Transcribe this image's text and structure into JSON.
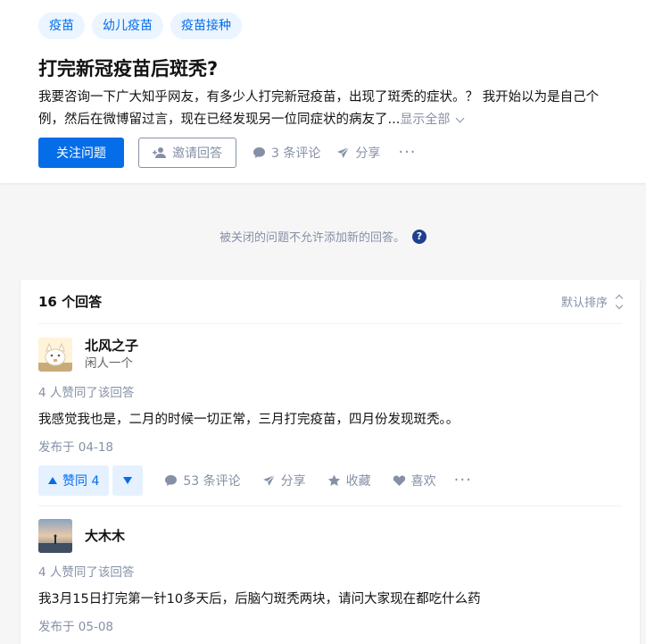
{
  "question": {
    "topics": [
      "疫苗",
      "幼儿疫苗",
      "疫苗接种"
    ],
    "title": "打完新冠疫苗后斑秃?",
    "detail_line1": "我要咨询一下广大知乎网友，有多少人打完新冠疫苗，出现了斑秃的症状。？ 我开始以为是自己个",
    "detail_line2": "例，然后在微博留过言，现在已经发现另一位同症状的病友了...",
    "show_all": "显示全部",
    "follow_label": "关注问题",
    "invite_label": "邀请回答",
    "comments_label": "3 条评论",
    "share_label": "分享",
    "more": "···"
  },
  "closed_notice": "被关闭的问题不允许添加新的回答。",
  "help_icon_glyph": "?",
  "answers_header": {
    "count_label": "16 个回答",
    "sort_label": "默认排序"
  },
  "answers": [
    {
      "author": "北风之子",
      "bio": "闲人一个",
      "votes_meta": "4 人赞同了该回答",
      "text": "我感觉我也是，二月的时候一切正常，三月打完疫苗，四月份发现斑秃。。",
      "time": "发布于 04-18",
      "upvote_label": "赞同 4",
      "comments": "53 条评论",
      "share": "分享",
      "collect": "收藏",
      "like": "喜欢",
      "more": "···"
    },
    {
      "author": "大木木",
      "bio": "",
      "votes_meta": "4 人赞同了该回答",
      "text": "我3月15日打完第一针10多天后，后脑勺斑秃两块，请问大家现在都吃什么药",
      "time": "发布于 05-08"
    }
  ],
  "colors": {
    "brand": "#056de8",
    "brand_light": "#ebf5ff",
    "muted": "#8590a6",
    "help_icon": "#1f3f8f"
  }
}
